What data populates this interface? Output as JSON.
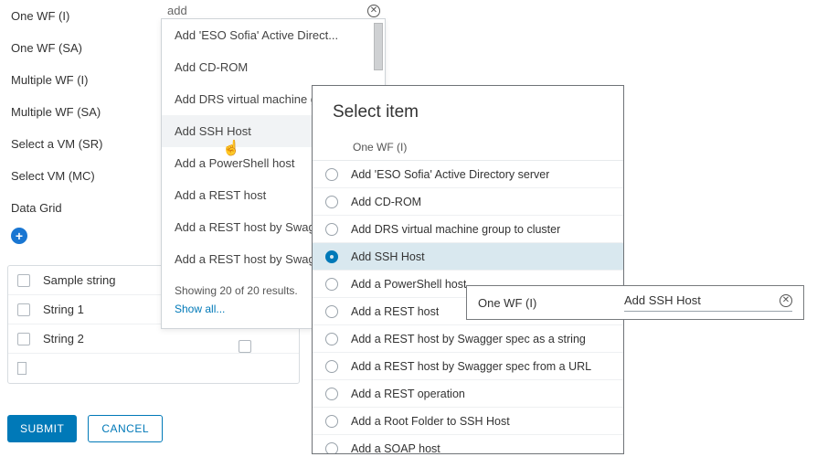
{
  "sidebar": {
    "items": [
      "One WF (I)",
      "One WF (SA)",
      "Multiple WF (I)",
      "Multiple WF (SA)",
      "Select a VM (SR)",
      "Select VM (MC)",
      "Data Grid"
    ]
  },
  "grid": {
    "header": "Sample string",
    "rows": [
      "String 1",
      "String 2"
    ]
  },
  "buttons": {
    "submit": "SUBMIT",
    "cancel": "CANCEL"
  },
  "search": {
    "value": "add"
  },
  "dropdown": {
    "items": [
      "Add 'ESO Sofia' Active Direct...",
      "Add CD-ROM",
      "Add DRS virtual machine gro..",
      "Add SSH Host",
      "Add a PowerShell host",
      "Add a REST host",
      "Add a REST host by Swagger",
      "Add a REST host by Swagger"
    ],
    "hover_index": 3,
    "showing": "Showing 20 of 20 results.",
    "show_all": "Show all..."
  },
  "dialog": {
    "title": "Select item",
    "header": "One WF (I)",
    "options": [
      "Add 'ESO Sofia' Active Directory server",
      "Add CD-ROM",
      "Add DRS virtual machine group to cluster",
      "Add SSH Host",
      "Add a PowerShell host",
      "Add a REST host",
      "Add a REST host by Swagger spec as a string",
      "Add a REST host by Swagger spec from a URL",
      "Add a REST operation",
      "Add a Root Folder to SSH Host",
      "Add a SOAP host"
    ],
    "selected_index": 3
  },
  "popover": {
    "label": "One WF (I)",
    "value": "Add SSH Host"
  }
}
